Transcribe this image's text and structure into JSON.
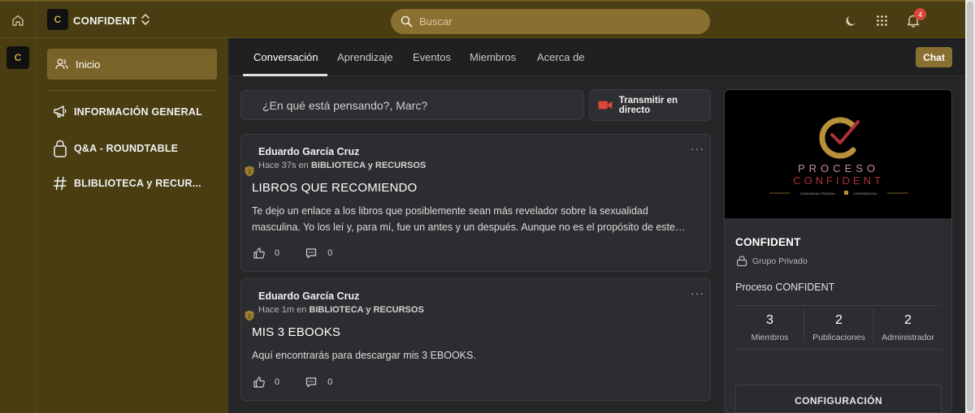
{
  "brand": {
    "name": "CONFIDENT",
    "logo_letter": "C"
  },
  "search": {
    "placeholder": "Buscar"
  },
  "notifications": {
    "count": "4"
  },
  "sidebar": {
    "home": "Inicio",
    "items": [
      {
        "label": "INFORMACIÓN GENERAL",
        "icon": "megaphone-icon"
      },
      {
        "label": "Q&A - ROUNDTABLE",
        "icon": "lock-chat-icon"
      },
      {
        "label": "BLIBLIOTECA y RECUR...",
        "icon": "hash-icon"
      }
    ]
  },
  "tabs": [
    "Conversación",
    "Aprendizaje",
    "Eventos",
    "Miembros",
    "Acerca de"
  ],
  "chat_button": "Chat",
  "composer": {
    "placeholder": "¿En qué está pensando?, Marc?",
    "live_label": "Transmitir en directo"
  },
  "posts": [
    {
      "author": "Eduardo García Cruz",
      "time": "Hace 37s",
      "in_word": "en",
      "channel": "BIBLIOTECA y RECURSOS",
      "badge": "1",
      "more": "···",
      "title": "LIBROS QUE RECOMIENDO",
      "body": "Te dejo un enlace a los libros que posiblemente sean más revelador sobre la sexualidad masculina. Yo los leí y, para mí, fue un antes y un después. Aunque no es el propósito de este…",
      "likes": "0",
      "comments": "0"
    },
    {
      "author": "Eduardo García Cruz",
      "time": "Hace 1m",
      "in_word": "en",
      "channel": "BIBLIOTECA y RECURSOS",
      "badge": "1",
      "more": "···",
      "title": "MIS 3 EBOOKS",
      "body": "Aquí encontrarás para descargar mis 3 EBOOKS.",
      "likes": "0",
      "comments": "0"
    }
  ],
  "group": {
    "banner_line1": "PROCESO",
    "banner_line2": "CONFIDENT",
    "banner_tagline_left": "COMUNIDAD PRIVADA",
    "banner_tagline_right": "CONFIDENCIAL",
    "name": "CONFIDENT",
    "privacy": "Grupo Privado",
    "description": "Proceso CONFIDENT",
    "stats": [
      {
        "value": "3",
        "label": "Miembros"
      },
      {
        "value": "2",
        "label": "Publicaciones"
      },
      {
        "value": "2",
        "label": "Administrador"
      }
    ],
    "config_label": "CONFIGURACIÓN"
  },
  "colors": {
    "brand_bar": "#4a3d12",
    "accent": "#8a7030",
    "active_item": "#7a6329",
    "background": "#252628"
  }
}
